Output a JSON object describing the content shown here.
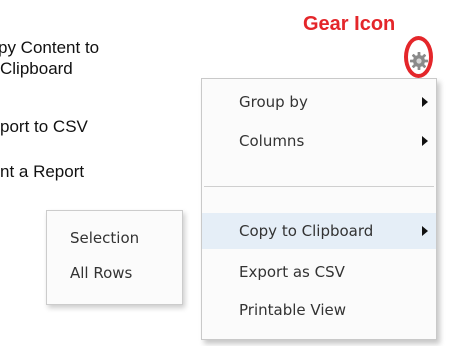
{
  "annotation": {
    "gear_label": "Gear Icon"
  },
  "left_labels": {
    "line1": "py Content to",
    "line2": "Clipboard",
    "line3": "port to CSV",
    "line4": "nt a Report"
  },
  "gear_menu": {
    "items": [
      {
        "label": "Group by",
        "has_submenu": true
      },
      {
        "label": "Columns",
        "has_submenu": true
      },
      {
        "label": "Copy to Clipboard",
        "has_submenu": true,
        "highlighted": true
      },
      {
        "label": "Export as CSV",
        "has_submenu": false
      },
      {
        "label": "Printable View",
        "has_submenu": false
      }
    ]
  },
  "clipboard_submenu": {
    "items": [
      {
        "label": "Selection"
      },
      {
        "label": "All Rows"
      }
    ]
  },
  "colors": {
    "annotation_red": "#e4262a",
    "highlight_bg": "#e5eef7",
    "menu_bg": "#fbfbfb"
  },
  "icons": {
    "gear": "gear-icon",
    "submenu_arrow": "chevron-right-icon"
  }
}
